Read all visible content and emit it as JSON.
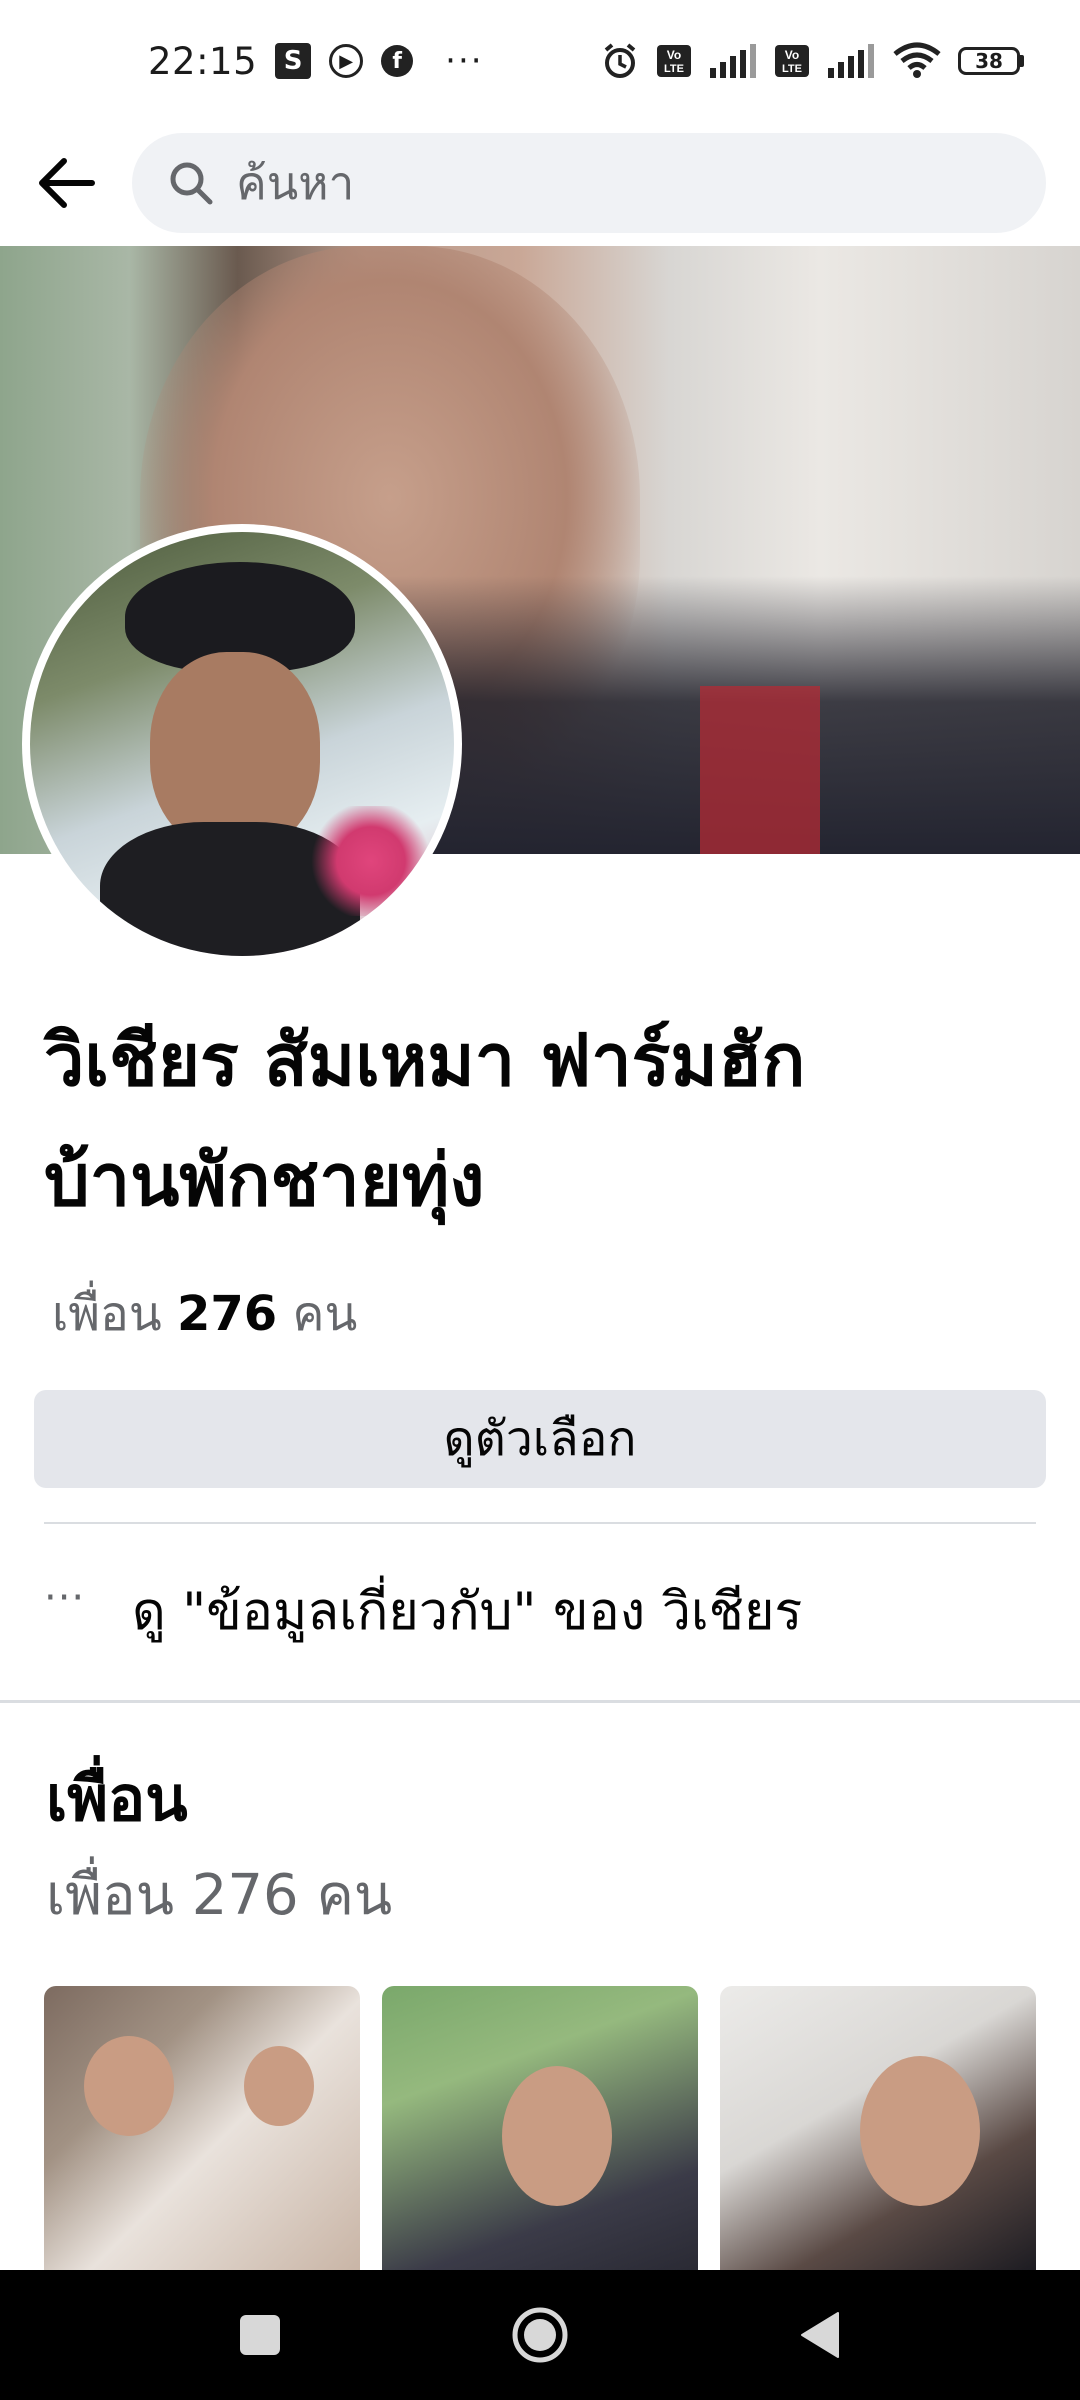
{
  "status_bar": {
    "time": "22:15",
    "notif_s": "S",
    "notif_fb": "f",
    "more": "···",
    "battery": "38",
    "icons": [
      "alarm-icon",
      "volte-icon",
      "signal-icon",
      "volte-icon",
      "signal-icon",
      "wifi-icon",
      "battery-icon"
    ]
  },
  "header": {
    "search_placeholder": "ค้นหา"
  },
  "profile": {
    "name_line1": "วิเชียร สัมเหมา ฟาร์มฮัก",
    "name_line2": "บ้านพักชายทุ่ง",
    "friends_prefix": "เพื่อน",
    "friends_number": "276",
    "friends_suffix": "คน",
    "options_button": "ดูตัวเลือก",
    "about_dots": "···",
    "about_link": "ดู \"ข้อมูลเกี่ยวกับ\" ของ วิเชียร"
  },
  "friends_section": {
    "title": "เพื่อน",
    "subtitle": "เพื่อน 276 คน"
  },
  "colors": {
    "text": "#050505",
    "secondary_text": "#65676b",
    "button_bg": "#e4e6eb",
    "search_bg": "#f0f2f5",
    "nav_bar": "#000000"
  }
}
